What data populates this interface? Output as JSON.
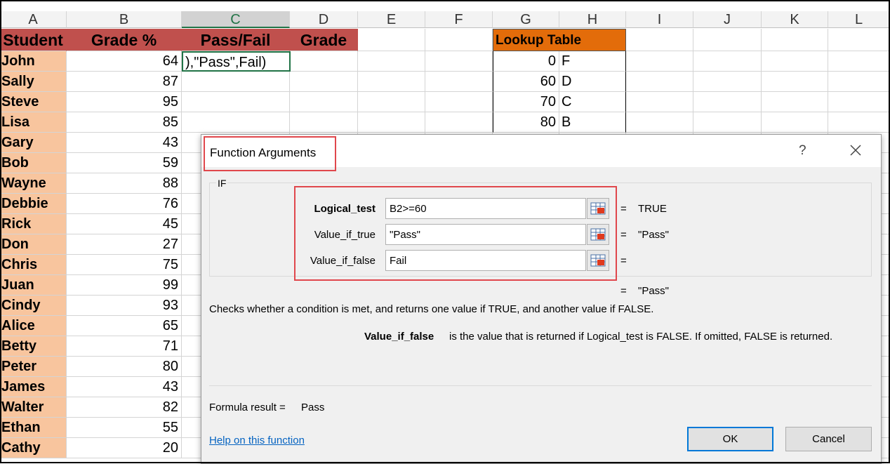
{
  "columns": [
    "A",
    "B",
    "C",
    "D",
    "E",
    "F",
    "G",
    "H",
    "I",
    "J",
    "K",
    "L"
  ],
  "headers": {
    "student": "Student",
    "grade_pct": "Grade %",
    "pass_fail": "Pass/Fail",
    "grade": "Grade",
    "lookup": "Lookup Table"
  },
  "active_cell_text": "),\"Pass\",Fail)",
  "students": [
    {
      "name": "John",
      "grade": "64"
    },
    {
      "name": "Sally",
      "grade": "87"
    },
    {
      "name": "Steve",
      "grade": "95"
    },
    {
      "name": "Lisa",
      "grade": "85"
    },
    {
      "name": "Gary",
      "grade": "43"
    },
    {
      "name": "Bob",
      "grade": "59"
    },
    {
      "name": "Wayne",
      "grade": "88"
    },
    {
      "name": "Debbie",
      "grade": "76"
    },
    {
      "name": "Rick",
      "grade": "45"
    },
    {
      "name": "Don",
      "grade": "27"
    },
    {
      "name": "Chris",
      "grade": "75"
    },
    {
      "name": "Juan",
      "grade": "99"
    },
    {
      "name": "Cindy",
      "grade": "93"
    },
    {
      "name": "Alice",
      "grade": "65"
    },
    {
      "name": "Betty",
      "grade": "71"
    },
    {
      "name": "Peter",
      "grade": "80"
    },
    {
      "name": "James",
      "grade": "43"
    },
    {
      "name": "Walter",
      "grade": "82"
    },
    {
      "name": "Ethan",
      "grade": "55"
    },
    {
      "name": "Cathy",
      "grade": "20"
    }
  ],
  "lookup": [
    {
      "score": "0",
      "letter": "F"
    },
    {
      "score": "60",
      "letter": "D"
    },
    {
      "score": "70",
      "letter": "C"
    },
    {
      "score": "80",
      "letter": "B"
    }
  ],
  "dialog": {
    "title": "Function Arguments",
    "help": "?",
    "function_name": "IF",
    "args": [
      {
        "label": "Logical_test",
        "value": "B2>=60",
        "result": "TRUE"
      },
      {
        "label": "Value_if_true",
        "value": "\"Pass\"",
        "result": "\"Pass\""
      },
      {
        "label": "Value_if_false",
        "value": "Fail",
        "result": ""
      }
    ],
    "equals": "=",
    "overall_result": "\"Pass\"",
    "description": "Checks whether a condition is met, and returns one value if TRUE, and another value if FALSE.",
    "arg_desc_name": "Value_if_false",
    "arg_desc_text": "is the value that is returned if Logical_test is FALSE. If omitted, FALSE is returned.",
    "formula_result_label": "Formula result =",
    "formula_result_value": "Pass",
    "help_link": "Help on this function",
    "ok": "OK",
    "cancel": "Cancel"
  }
}
